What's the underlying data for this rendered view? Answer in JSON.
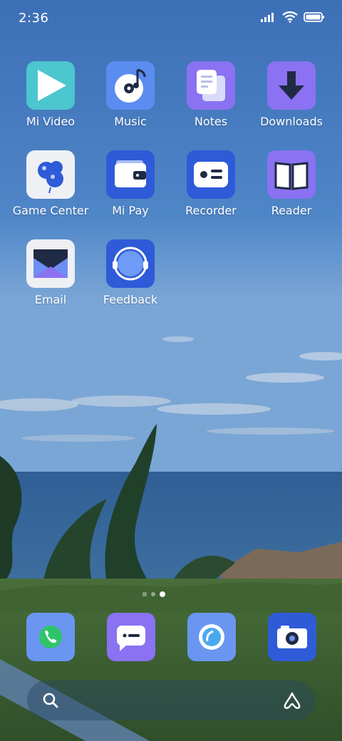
{
  "status_bar": {
    "time": "2:36",
    "icons": [
      "signal-icon",
      "wifi-icon",
      "battery-icon"
    ]
  },
  "apps": [
    {
      "label": "Mi Video",
      "icon": "play-icon",
      "color": "#4cc6cf"
    },
    {
      "label": "Music",
      "icon": "music-disc-icon",
      "color": "#5b8cf0"
    },
    {
      "label": "Notes",
      "icon": "notes-icon",
      "color": "#8a72f2"
    },
    {
      "label": "Downloads",
      "icon": "download-arrow-icon",
      "color": "#8a72f2"
    },
    {
      "label": "Game Center",
      "icon": "balloons-icon",
      "color": "#eef0f4"
    },
    {
      "label": "Mi Pay",
      "icon": "wallet-icon",
      "color": "#2f5bd8"
    },
    {
      "label": "Recorder",
      "icon": "recorder-icon",
      "color": "#2f5bd8"
    },
    {
      "label": "Reader",
      "icon": "book-icon",
      "color": "#8a72f2"
    },
    {
      "label": "Email",
      "icon": "envelope-icon",
      "color": "#eef0f4"
    },
    {
      "label": "Feedback",
      "icon": "headset-icon",
      "color": "#2f5bd8"
    }
  ],
  "page_indicator": {
    "pages": 3,
    "current": 3
  },
  "dock": [
    {
      "icon": "phone-icon",
      "color": "#6a96f2"
    },
    {
      "icon": "message-icon",
      "color": "#8a72f2"
    },
    {
      "icon": "browser-icon",
      "color": "#6a96f2"
    },
    {
      "icon": "camera-icon",
      "color": "#2f5bd8"
    }
  ],
  "search_bar": {
    "left_icon": "search-icon",
    "right_icon": "assistant-icon"
  }
}
